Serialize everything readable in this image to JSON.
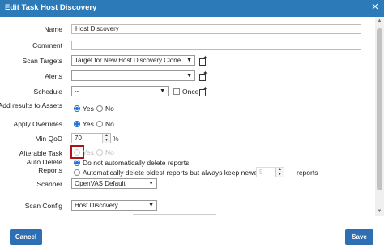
{
  "dialog": {
    "title": "Edit Task Host Discovery",
    "close_glyph": "×"
  },
  "form": {
    "name": {
      "label": "Name",
      "value": "Host Discovery"
    },
    "comment": {
      "label": "Comment",
      "value": ""
    },
    "scan_targets": {
      "label": "Scan Targets",
      "value": "Target for New Host Discovery Clone"
    },
    "alerts": {
      "label": "Alerts",
      "value": ""
    },
    "schedule": {
      "label": "Schedule",
      "value": "--",
      "once_label": "Once",
      "once_checked": false
    },
    "add_results": {
      "label": "Add results to Assets",
      "options": [
        "Yes",
        "No"
      ],
      "selected": "Yes"
    },
    "apply_overrides": {
      "label": "Apply Overrides",
      "options": [
        "Yes",
        "No"
      ],
      "selected": "Yes"
    },
    "min_qod": {
      "label": "Min QoD",
      "value": "70",
      "unit": "%"
    },
    "alterable_task": {
      "label": "Alterable Task",
      "options": [
        "Yes",
        "No"
      ],
      "selected": null
    },
    "auto_delete": {
      "label": "Auto Delete Reports",
      "option_none": "Do not automatically delete reports",
      "option_keep": "Automatically delete oldest reports but always keep newest",
      "keep_value": "5",
      "keep_suffix": "reports",
      "selected": "none"
    },
    "scanner": {
      "label": "Scanner",
      "value": "OpenVAS Default"
    },
    "scan_config": {
      "label": "Scan Config",
      "value": "Host Discovery"
    }
  },
  "footer": {
    "cancel_label": "Cancel",
    "save_label": "Save"
  },
  "colors": {
    "header": "#2d7ab9",
    "button": "#2d6eb5",
    "highlight": "#b0141a",
    "radio_on": "#1a6fd8"
  }
}
